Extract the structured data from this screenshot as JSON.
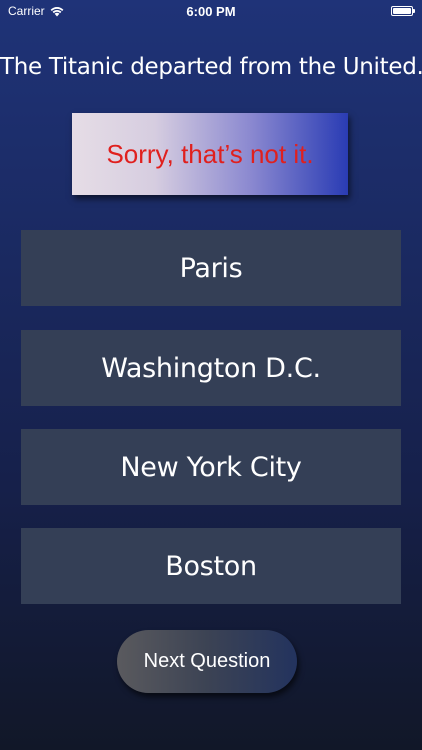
{
  "status_bar": {
    "carrier": "Carrier",
    "time": "6:00 PM",
    "wifi_icon": "wifi-icon",
    "battery_icon": "battery-icon",
    "battery_level": 1.0
  },
  "question": {
    "text": "The Titanic departed from the United..."
  },
  "feedback": {
    "text": "Sorry, that’s not it.",
    "text_color": "#e0201e"
  },
  "answers": [
    {
      "label": "Paris"
    },
    {
      "label": "Washington D.C."
    },
    {
      "label": "New York City"
    },
    {
      "label": "Boston"
    }
  ],
  "next_button": {
    "label": "Next Question"
  },
  "colors": {
    "background_top": "#1f3378",
    "background_bottom": "#111728",
    "answer_button": "#343f56"
  }
}
